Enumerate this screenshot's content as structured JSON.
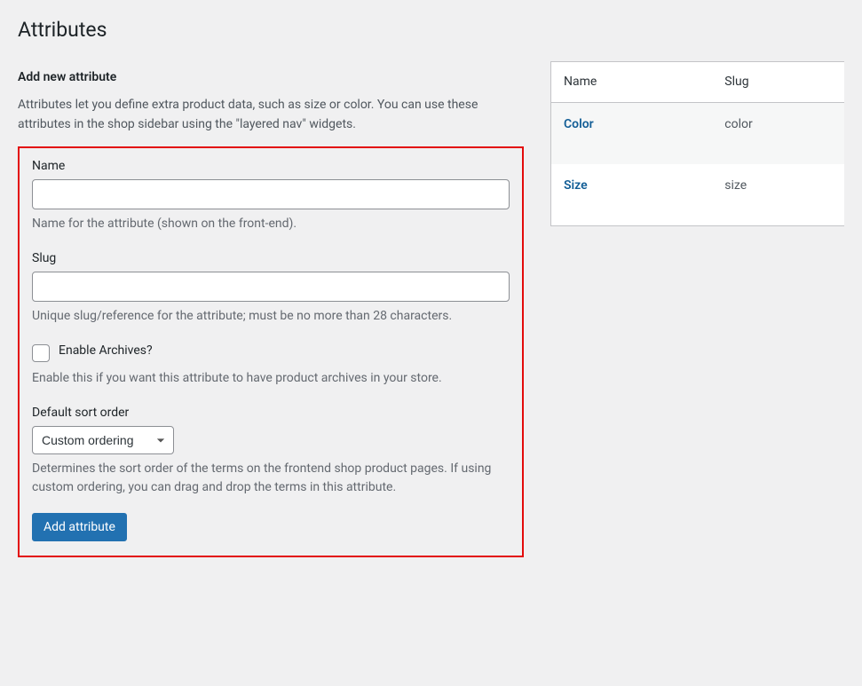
{
  "page": {
    "title": "Attributes"
  },
  "form": {
    "heading": "Add new attribute",
    "intro": "Attributes let you define extra product data, such as size or color. You can use these attributes in the shop sidebar using the \"layered nav\" widgets.",
    "name_label": "Name",
    "name_value": "",
    "name_description": "Name for the attribute (shown on the front-end).",
    "slug_label": "Slug",
    "slug_value": "",
    "slug_description": "Unique slug/reference for the attribute; must be no more than 28 characters.",
    "archives_label": "Enable Archives?",
    "archives_description": "Enable this if you want this attribute to have product archives in your store.",
    "sort_label": "Default sort order",
    "sort_value": "Custom ordering",
    "sort_description": "Determines the sort order of the terms on the frontend shop product pages. If using custom ordering, you can drag and drop the terms in this attribute.",
    "submit_label": "Add attribute"
  },
  "table": {
    "head": {
      "name": "Name",
      "slug": "Slug"
    },
    "rows": [
      {
        "name": "Color",
        "slug": "color"
      },
      {
        "name": "Size",
        "slug": "size"
      }
    ]
  }
}
